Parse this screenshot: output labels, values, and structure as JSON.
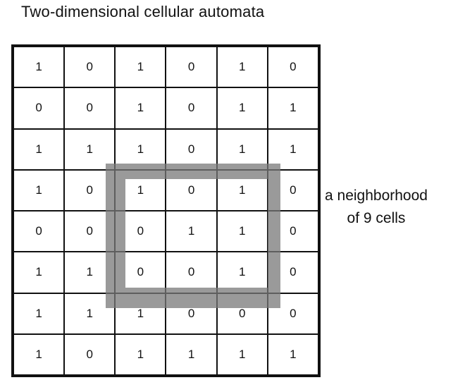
{
  "title": "Two-dimensional cellular automata",
  "grid": [
    [
      1,
      0,
      1,
      0,
      1,
      0
    ],
    [
      0,
      0,
      1,
      0,
      1,
      1
    ],
    [
      1,
      1,
      1,
      0,
      1,
      1
    ],
    [
      1,
      0,
      1,
      0,
      1,
      0
    ],
    [
      0,
      0,
      0,
      1,
      1,
      0
    ],
    [
      1,
      1,
      0,
      0,
      1,
      0
    ],
    [
      1,
      1,
      1,
      0,
      0,
      0
    ],
    [
      1,
      0,
      1,
      1,
      1,
      1
    ]
  ],
  "neighborhood": {
    "rows": [
      3,
      5
    ],
    "cols": [
      2,
      4
    ],
    "color": "#808080",
    "label_line1": "a neighborhood",
    "label_line2": "of 9 cells"
  }
}
